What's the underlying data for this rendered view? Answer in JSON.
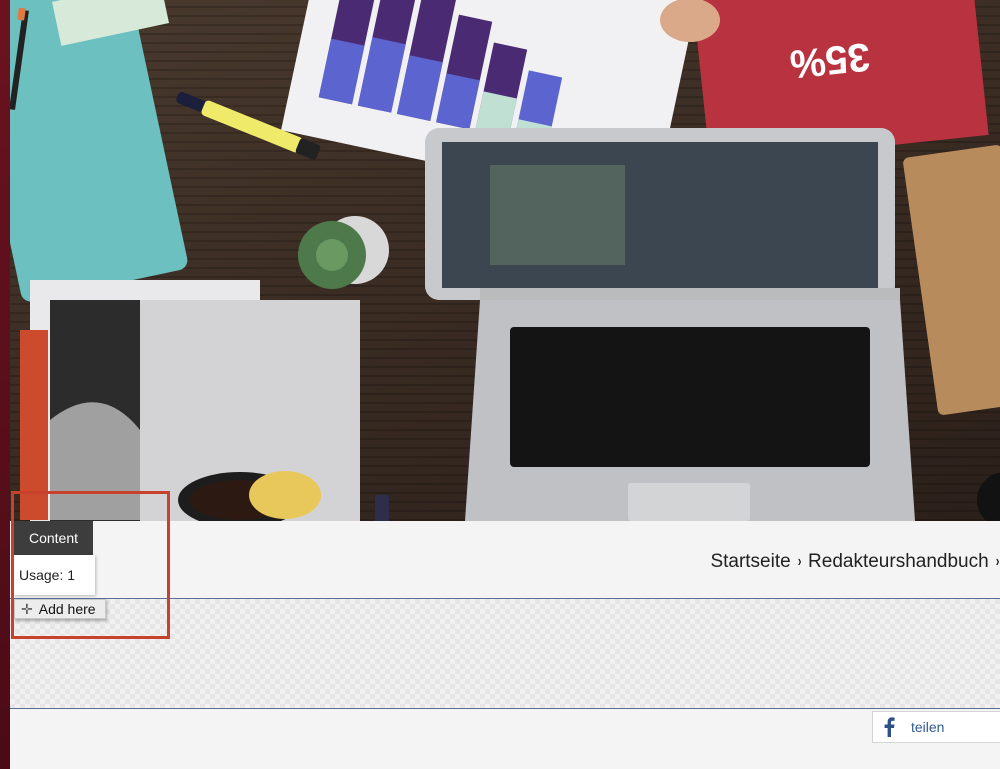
{
  "hero": {
    "image_label": "Desk with laptop, notebooks and charts"
  },
  "breadcrumb": {
    "items": [
      "Startseite",
      "Redakteurshandbuch"
    ],
    "separator": "›"
  },
  "editor": {
    "content_tag": "Content",
    "usage_label": "Usage: 1",
    "add_here_label": "Add here",
    "highlight_color": "#c8412d"
  },
  "share": {
    "label": "teilen",
    "icon": "facebook-icon",
    "color": "#2f5c94"
  },
  "colors": {
    "side_strip": "#5a0e1b",
    "drop_zone_border": "#5a6e96"
  }
}
